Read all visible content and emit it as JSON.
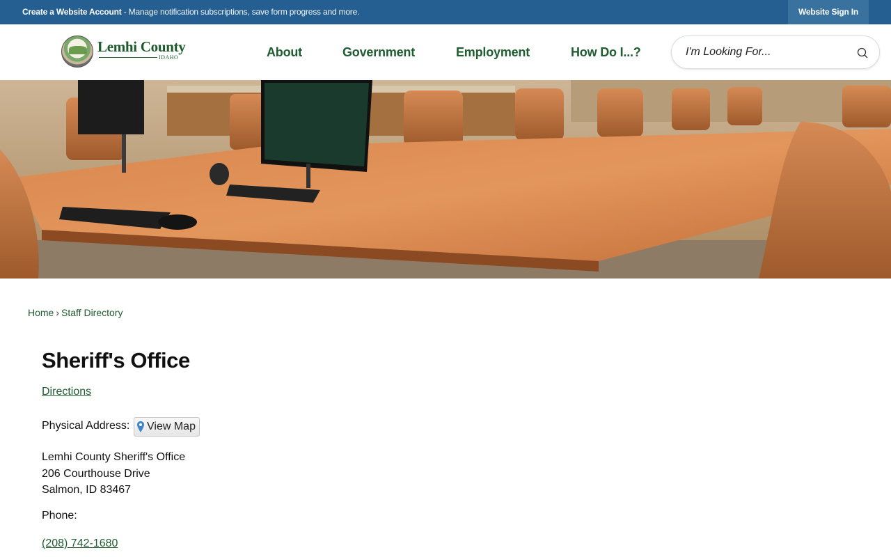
{
  "topbar": {
    "create_account": "Create a Website Account",
    "create_account_desc": " - Manage notification subscriptions, save form progress and more.",
    "sign_in": "Website Sign In"
  },
  "header": {
    "logo_text": "Lemhi County",
    "logo_subtext": "IDAHO",
    "nav": [
      "About",
      "Government",
      "Employment",
      "How Do I...?"
    ],
    "search_placeholder": "I'm Looking For..."
  },
  "breadcrumb": {
    "home": "Home",
    "separator": "›",
    "current": "Staff Directory"
  },
  "content": {
    "title": "Sheriff's Office",
    "directions_link": "Directions",
    "physical_address_label": "Physical Address:",
    "view_map": "View Map",
    "address_lines": [
      "Lemhi County Sheriff's Office",
      "206 Courthouse Drive",
      "Salmon, ID 83467"
    ],
    "phone_label": "Phone:",
    "phone": "(208) 742-1680"
  },
  "colors": {
    "topbar": "#255f92",
    "signin_bg": "#3a729f",
    "nav_green": "#1f5c30",
    "link_green": "#1f5c30"
  },
  "icons": {
    "search": "search-icon",
    "map_pin": "map-pin-icon",
    "seal": "county-seal-icon"
  }
}
